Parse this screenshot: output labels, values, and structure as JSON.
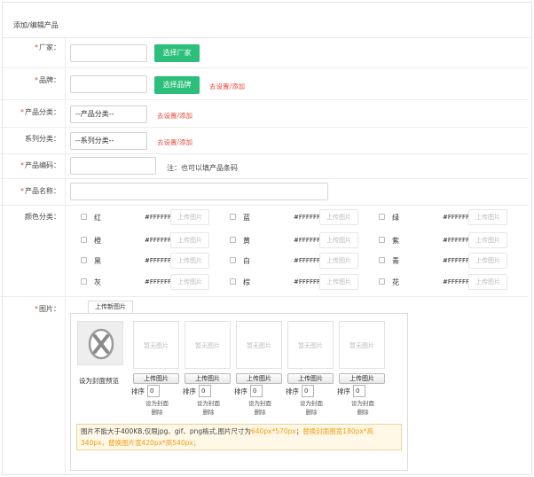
{
  "header": {
    "title": "添加/编辑产品"
  },
  "fields": {
    "manufacturer": {
      "label": "厂家：",
      "button": "选择厂家"
    },
    "brand": {
      "label": "品牌：",
      "button": "选择品牌",
      "link": "去设置/添加"
    },
    "category": {
      "label": "产品分类：",
      "selected": "--产品分类--",
      "link": "去设置/添加"
    },
    "series": {
      "label": "系列分类：",
      "selected": "--系列分类--",
      "link": "去设置/添加"
    },
    "code": {
      "label": "产品编码：",
      "note": "注：也可以填产品条码"
    },
    "name": {
      "label": "产品名称："
    },
    "colors": {
      "label": "颜色分类：",
      "upload_placeholder": "上传图片",
      "items": [
        {
          "name": "红",
          "hex": "#FFFFFF"
        },
        {
          "name": "蓝",
          "hex": "#FFFFFF"
        },
        {
          "name": "绿",
          "hex": "#FFFFFF"
        },
        {
          "name": "橙",
          "hex": "#FFFFFF"
        },
        {
          "name": "黄",
          "hex": "#FFFFFF"
        },
        {
          "name": "紫",
          "hex": "#FFFFFF"
        },
        {
          "name": "黑",
          "hex": "#FFFFFF"
        },
        {
          "name": "白",
          "hex": "#FFFFFF"
        },
        {
          "name": "青",
          "hex": "#FFFFFF"
        },
        {
          "name": "灰",
          "hex": "#FFFFFF"
        },
        {
          "name": "棕",
          "hex": "#FFFFFF"
        },
        {
          "name": "花",
          "hex": "#FFFFFF"
        }
      ]
    },
    "images": {
      "label": "图片：",
      "tab": "上传新图片",
      "cover_label": "设为封面预览",
      "slots": [
        {
          "placeholder": "暂无图片",
          "upload": "上传图片",
          "sort_label": "排序",
          "sort": "0",
          "set_cover": "设为封面",
          "delete": "删除"
        },
        {
          "placeholder": "暂无图片",
          "upload": "上传图片",
          "sort_label": "排序",
          "sort": "0",
          "set_cover": "设为封面",
          "delete": "删除"
        },
        {
          "placeholder": "暂无图片",
          "upload": "上传图片",
          "sort_label": "排序",
          "sort": "0",
          "set_cover": "设为封面",
          "delete": "删除"
        },
        {
          "placeholder": "暂无图片",
          "upload": "上传图片",
          "sort_label": "排序",
          "sort": "0",
          "set_cover": "设为封面",
          "delete": "删除"
        },
        {
          "placeholder": "暂无图片",
          "upload": "上传图片",
          "sort_label": "排序",
          "sort": "0",
          "set_cover": "设为封面",
          "delete": "删除"
        }
      ],
      "tip_part1": "图片不能大于400KB,仅限jpg、gif、png格式,图片尺寸为",
      "tip_size": "640px*570px",
      "tip_part2": "；",
      "tip_cover": "替换封面图宽180px*高340px，替换图片宽420px*高540px；"
    }
  },
  "accent": {
    "green": "#2bbf79",
    "red": "#e84a3c",
    "orange": "#f39c12"
  }
}
